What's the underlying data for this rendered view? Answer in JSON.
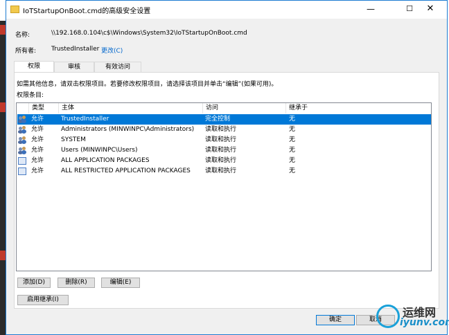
{
  "window": {
    "title": "IoTStartupOnBoot.cmd的高级安全设置",
    "minimize_glyph": "—",
    "maximize_glyph": "☐",
    "close_glyph": "✕"
  },
  "name_row": {
    "label": "名称:",
    "value": "\\\\192.168.0.104\\c$\\Windows\\System32\\IoTStartupOnBoot.cmd"
  },
  "owner_row": {
    "label": "所有者:",
    "value": "TrustedInstaller",
    "change_link": "更改(C)"
  },
  "tabs": [
    {
      "label": "权限",
      "active": true
    },
    {
      "label": "审核",
      "active": false
    },
    {
      "label": "有效访问",
      "active": false
    }
  ],
  "info_text": "如需其他信息，请双击权限项目。若要修改权限项目，请选择该项目并单击“编辑”(如果可用)。",
  "entries_label": "权限条目:",
  "grid": {
    "headers": [
      "类型",
      "主体",
      "访问",
      "继承于"
    ],
    "rows": [
      {
        "icon": "users-icon",
        "type": "允许",
        "principal": "TrustedInstaller",
        "access": "完全控制",
        "inherited": "无",
        "selected": true
      },
      {
        "icon": "users-icon",
        "type": "允许",
        "principal": "Administrators (MINWINPC\\Administrators)",
        "access": "读取和执行",
        "inherited": "无",
        "selected": false
      },
      {
        "icon": "users-icon",
        "type": "允许",
        "principal": "SYSTEM",
        "access": "读取和执行",
        "inherited": "无",
        "selected": false
      },
      {
        "icon": "users-icon",
        "type": "允许",
        "principal": "Users (MINWINPC\\Users)",
        "access": "读取和执行",
        "inherited": "无",
        "selected": false
      },
      {
        "icon": "package-icon",
        "type": "允许",
        "principal": "ALL APPLICATION PACKAGES",
        "access": "读取和执行",
        "inherited": "无",
        "selected": false
      },
      {
        "icon": "package-icon",
        "type": "允许",
        "principal": "ALL RESTRICTED APPLICATION PACKAGES",
        "access": "读取和执行",
        "inherited": "无",
        "selected": false
      }
    ]
  },
  "buttons": {
    "add": "添加(D)",
    "remove": "删除(R)",
    "edit": "编辑(E)",
    "enable_inheritance": "启用继承(I)"
  },
  "footer": {
    "ok": "确定",
    "cancel": "取消"
  },
  "watermark": {
    "cn": "运维网",
    "en": "iyunv.com"
  },
  "colors": {
    "selection": "#0078d7",
    "link": "#0066cc",
    "accent_border": "#1c7bd1"
  }
}
